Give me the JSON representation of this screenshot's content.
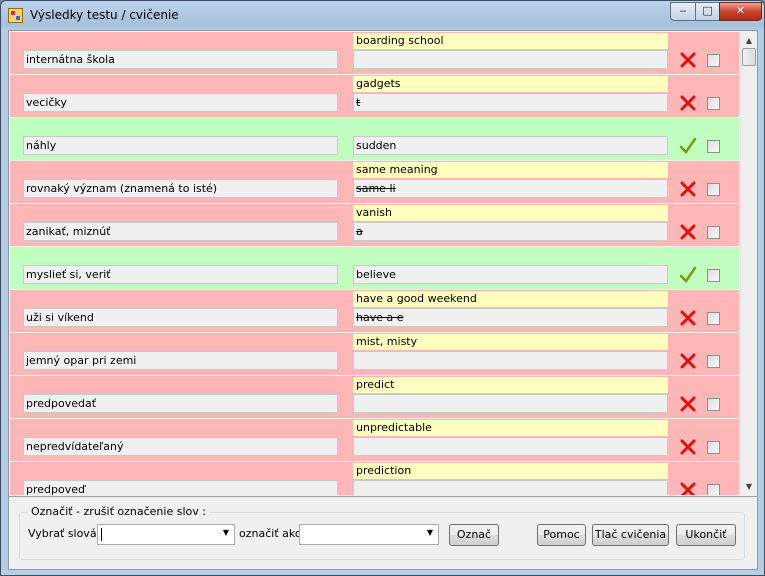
{
  "window": {
    "title": "Výsledky testu / cvičenie",
    "controls": {
      "minimize": "‒",
      "maximize": "□",
      "close": "✕"
    }
  },
  "rows": [
    {
      "source": "internátna škola",
      "correct": "boarding school",
      "answer": "",
      "status": "wrong"
    },
    {
      "source": "vecičky",
      "correct": "gadgets",
      "answer": "t",
      "status": "wrong"
    },
    {
      "source": "náhly",
      "correct": "",
      "answer": "sudden",
      "status": "right"
    },
    {
      "source": "rovnaký význam (znamená to isté)",
      "correct": "same meaning",
      "answer": "same li",
      "status": "wrong"
    },
    {
      "source": "zanikať, miznúť",
      "correct": "vanish",
      "answer": "a",
      "status": "wrong"
    },
    {
      "source": "myslieť si, veriť",
      "correct": "",
      "answer": "believe",
      "status": "right"
    },
    {
      "source": "uži si víkend",
      "correct": "have a good weekend",
      "answer": "have a e",
      "status": "wrong"
    },
    {
      "source": "jemný opar pri zemi",
      "correct": "mist, misty",
      "answer": "",
      "status": "wrong"
    },
    {
      "source": "predpovedať",
      "correct": "predict",
      "answer": "",
      "status": "wrong"
    },
    {
      "source": "nepredvídateľaný",
      "correct": "unpredictable",
      "answer": "",
      "status": "wrong"
    },
    {
      "source": "predpoveď",
      "correct": "prediction",
      "answer": "",
      "status": "wrong"
    }
  ],
  "colors": {
    "wrong": "#ffb6b6",
    "right": "#c0ffc0",
    "correct_hint": "#ffffc0",
    "cross": "#e01010",
    "check": "#7a9a10"
  },
  "icons": {
    "wrong": "cross-icon",
    "right": "checkmark-icon"
  },
  "bottom": {
    "group_label": "Označiť  - zrušiť označenie slov :",
    "select_label": "Vybrať slová",
    "select_value": "",
    "mark_as_label": "označiť ako",
    "mark_as_value": "",
    "mark_button": "Označ",
    "help_button": "Pomoc",
    "print_button": "Tlač cvičenia",
    "exit_button": "Ukončiť"
  }
}
